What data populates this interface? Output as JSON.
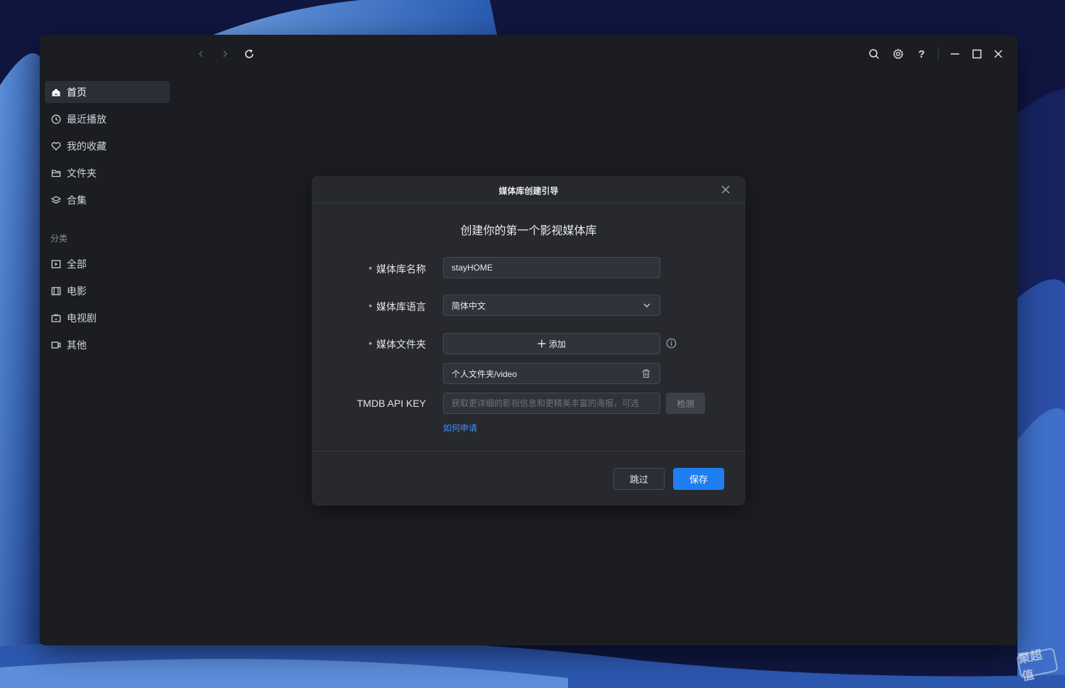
{
  "nav": {
    "items": [
      {
        "label": "首页",
        "icon": "home-icon",
        "active": true
      },
      {
        "label": "最近播放",
        "icon": "clock-icon"
      },
      {
        "label": "我的收藏",
        "icon": "heart-icon"
      },
      {
        "label": "文件夹",
        "icon": "folder-icon"
      },
      {
        "label": "合集",
        "icon": "layers-icon"
      }
    ],
    "section_label": "分类",
    "categories": [
      {
        "label": "全部",
        "icon": "play-square-icon"
      },
      {
        "label": "电影",
        "icon": "film-icon"
      },
      {
        "label": "电视剧",
        "icon": "tv-icon"
      },
      {
        "label": "其他",
        "icon": "video-camera-icon"
      }
    ]
  },
  "dialog": {
    "title": "媒体库创建引导",
    "subtitle": "创建你的第一个影视媒体库",
    "name_label": "媒体库名称",
    "name_value": "stayHOME",
    "language_label": "媒体库语言",
    "language_value": "简体中文",
    "folder_label": "媒体文件夹",
    "add_label": "添加",
    "folder_path": "个人文件夹/video",
    "tmdb_label": "TMDB API KEY",
    "tmdb_placeholder": "获取更详细的影视信息和更精美丰富的海报，可选",
    "detect_label": "检测",
    "how_link": "如何申请",
    "skip_label": "跳过",
    "save_label": "保存",
    "required_mark": "*"
  },
  "watermark": "聚超值",
  "colors": {
    "accent": "#1e7ef2",
    "link": "#3e8ef7",
    "window_bg": "#1b1d22",
    "dialog_bg": "#27292f"
  }
}
